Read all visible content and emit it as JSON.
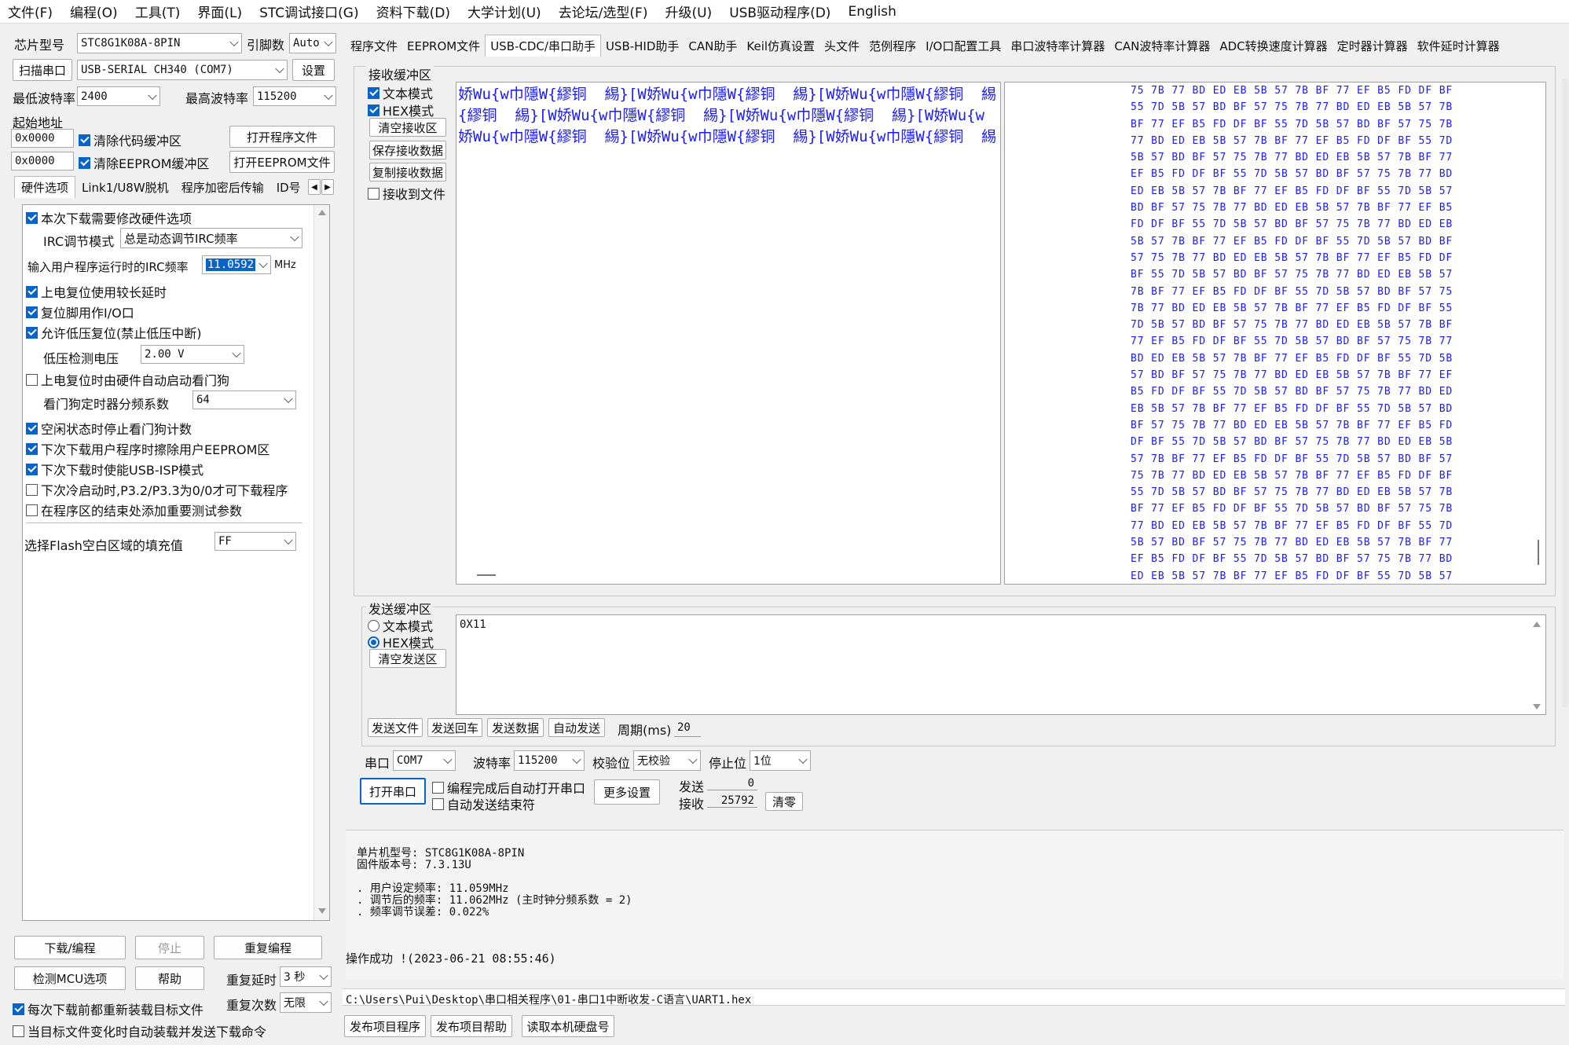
{
  "menu": [
    "文件(F)",
    "编程(O)",
    "工具(T)",
    "界面(L)",
    "STC调试接口(G)",
    "资料下载(D)",
    "大学计划(U)",
    "去论坛/选型(F)",
    "升级(U)",
    "USB驱动程序(D)",
    "English"
  ],
  "left": {
    "chip_label": "芯片型号",
    "chip_value": "STC8G1K08A-8PIN",
    "pin_label": "引脚数",
    "pin_value": "Auto",
    "scan_button": "扫描串口",
    "port_value": "USB-SERIAL CH340 (COM7)",
    "settings_button": "设置",
    "min_baud_label": "最低波特率",
    "min_baud_value": "2400",
    "max_baud_label": "最高波特率",
    "max_baud_value": "115200",
    "start_addr_label": "起始地址",
    "addr1": "0x0000",
    "clear_code": "清除代码缓冲区",
    "open_prog": "打开程序文件",
    "addr2": "0x0000",
    "clear_eeprom": "清除EEPROM缓冲区",
    "open_eeprom": "打开EEPROM文件",
    "tabs": [
      "硬件选项",
      "Link1/U8W脱机",
      "程序加密后传输",
      "ID号"
    ],
    "hw": {
      "opt_modify": "本次下载需要修改硬件选项",
      "irc_mode_label": "IRC调节模式",
      "irc_mode_value": "总是动态调节IRC频率",
      "irc_freq_label": "输入用户程序运行时的IRC频率",
      "irc_freq_value": "11.0592",
      "irc_freq_unit": "MHz",
      "opt_long_delay": "上电复位使用较长延时",
      "opt_reset_io": "复位脚用作I/O口",
      "opt_lvr": "允许低压复位(禁止低压中断)",
      "lv_label": "低压检测电压",
      "lv_value": "2.00 V",
      "opt_wdt": "上电复位时由硬件自动启动看门狗",
      "wdt_div_label": "看门狗定时器分频系数",
      "wdt_div_value": "64",
      "opt_idle_wdt": "空闲状态时停止看门狗计数",
      "opt_erase_eeprom": "下次下载用户程序时擦除用户EEPROM区",
      "opt_usb_isp": "下次下载时使能USB-ISP模式",
      "opt_cold_boot": "下次冷启动时,P3.2/P3.3为0/0才可下载程序",
      "opt_test_param": "在程序区的结束处添加重要测试参数",
      "flash_fill_label": "选择Flash空白区域的填充值",
      "flash_fill_value": "FF"
    },
    "download_button": "下载/编程",
    "stop_button": "停止",
    "reprogram_button": "重复编程",
    "detect_button": "检测MCU选项",
    "help_button": "帮助",
    "repeat_delay_label": "重复延时",
    "repeat_delay_value": "3 秒",
    "repeat_count_label": "重复次数",
    "repeat_count_value": "无限",
    "reload_each": "每次下载前都重新装载目标文件",
    "auto_load": "当目标文件变化时自动装载并发送下载命令"
  },
  "right_tabs": [
    "程序文件",
    "EEPROM文件",
    "USB-CDC/串口助手",
    "USB-HID助手",
    "CAN助手",
    "Keil仿真设置",
    "头文件",
    "范例程序",
    "I/O口配置工具",
    "串口波特率计算器",
    "CAN波特率计算器",
    "ADC转换速度计算器",
    "定时器计算器",
    "软件延时计算器"
  ],
  "recv": {
    "title": "接收缓冲区",
    "text_mode": "文本模式",
    "hex_mode": "HEX模式",
    "clear": "清空接收区",
    "save": "保存接收数据",
    "copy": "复制接收数据",
    "to_file": "接收到文件",
    "text_lines": [
      "娇Wu{w巾隱W{繆铜  緆}[W娇Wu{w巾隱W{繆铜  緆}[W娇Wu{w巾隱W{繆铜  緆",
      "{繆铜  緆}[W娇Wu{w巾隱W{繆铜  緆}[W娇Wu{w巾隱W{繆铜  緆}[W娇Wu{w",
      "娇Wu{w巾隱W{繆铜  緆}[W娇Wu{w巾隱W{繆铜  緆}[W娇Wu{w巾隱W{繆铜  緆"
    ],
    "hex_lines": [
      "75 7B 77 BD ED EB 5B 57 7B BF 77 EF B5 FD DF BF",
      "55 7D 5B 57 BD BF 57 75 7B 77 BD ED EB 5B 57 7B",
      "BF 77 EF B5 FD DF BF 55 7D 5B 57 BD BF 57 75 7B",
      "77 BD ED EB 5B 57 7B BF 77 EF B5 FD DF BF 55 7D",
      "5B 57 BD BF 57 75 7B 77 BD ED EB 5B 57 7B BF 77",
      "EF B5 FD DF BF 55 7D 5B 57 BD BF 57 75 7B 77 BD",
      "ED EB 5B 57 7B BF 77 EF B5 FD DF BF 55 7D 5B 57",
      "BD BF 57 75 7B 77 BD ED EB 5B 57 7B BF 77 EF B5",
      "FD DF BF 55 7D 5B 57 BD BF 57 75 7B 77 BD ED EB",
      "5B 57 7B BF 77 EF B5 FD DF BF 55 7D 5B 57 BD BF",
      "57 75 7B 77 BD ED EB 5B 57 7B BF 77 EF B5 FD DF",
      "BF 55 7D 5B 57 BD BF 57 75 7B 77 BD ED EB 5B 57",
      "7B BF 77 EF B5 FD DF BF 55 7D 5B 57 BD BF 57 75",
      "7B 77 BD ED EB 5B 57 7B BF 77 EF B5 FD DF BF 55",
      "7D 5B 57 BD BF 57 75 7B 77 BD ED EB 5B 57 7B BF",
      "77 EF B5 FD DF BF 55 7D 5B 57 BD BF 57 75 7B 77",
      "BD ED EB 5B 57 7B BF 77 EF B5 FD DF BF 55 7D 5B",
      "57 BD BF 57 75 7B 77 BD ED EB 5B 57 7B BF 77 EF",
      "B5 FD DF BF 55 7D 5B 57 BD BF 57 75 7B 77 BD ED",
      "EB 5B 57 7B BF 77 EF B5 FD DF BF 55 7D 5B 57 BD",
      "BF 57 75 7B 77 BD ED EB 5B 57 7B BF 77 EF B5 FD",
      "DF BF 55 7D 5B 57 BD BF 57 75 7B 77 BD ED EB 5B",
      "57 7B BF 77 EF B5 FD DF BF 55 7D 5B 57 BD BF 57",
      "75 7B 77 BD ED EB 5B 57 7B BF 77 EF B5 FD DF BF",
      "55 7D 5B 57 BD BF 57 75 7B 77 BD ED EB 5B 57 7B",
      "BF 77 EF B5 FD DF BF 55 7D 5B 57 BD BF 57 75 7B",
      "77 BD ED EB 5B 57 7B BF 77 EF B5 FD DF BF 55 7D",
      "5B 57 BD BF 57 75 7B 77 BD ED EB 5B 57 7B BF 77",
      "EF B5 FD DF BF 55 7D 5B 57 BD BF 57 75 7B 77 BD",
      "ED EB 5B 57 7B BF 77 EF B5 FD DF BF 55 7D 5B 57"
    ]
  },
  "send": {
    "title": "发送缓冲区",
    "text_mode": "文本模式",
    "hex_mode": "HEX模式",
    "clear": "清空发送区",
    "content": "0X11",
    "send_file": "发送文件",
    "send_enter": "发送回车",
    "send_data": "发送数据",
    "auto_send": "自动发送",
    "period_label": "周期(ms)",
    "period_value": "20"
  },
  "serial": {
    "port_label": "串口",
    "port_value": "COM7",
    "baud_label": "波特率",
    "baud_value": "115200",
    "parity_label": "校验位",
    "parity_value": "无校验",
    "stop_label": "停止位",
    "stop_value": "1位",
    "open_button": "打开串口",
    "auto_open": "编程完成后自动打开串口",
    "auto_end": "自动发送结束符",
    "more_button": "更多设置",
    "send_label": "发送",
    "send_count": "0",
    "recv_label": "接收",
    "recv_count": "25792",
    "clear_button": "清零"
  },
  "info": {
    "lines": [
      "单片机型号: STC8G1K08A-8PIN",
      "固件版本号: 7.3.13U",
      "",
      ". 用户设定频率: 11.059MHz",
      ". 调节后的频率: 11.062MHz (主时钟分频系数 = 2)",
      ". 频率调节误差: 0.022%"
    ],
    "status": "操作成功 !(2023-06-21 08:55:46)"
  },
  "path": "C:\\Users\\Pui\\Desktop\\串口相关程序\\01-串口1中断收发-C语言\\UART1.hex",
  "bottom_buttons": [
    "发布项目程序",
    "发布项目帮助",
    "读取本机硬盘号"
  ],
  "colors": {
    "accent": "#0a64c8",
    "hex_text": "#1a1aff"
  }
}
